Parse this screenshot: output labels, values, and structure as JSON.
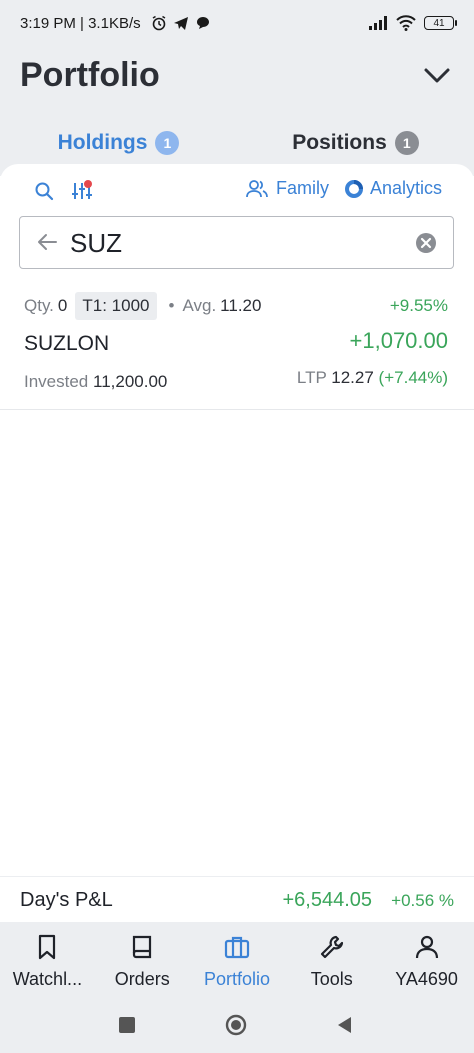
{
  "status_bar": {
    "time_speed": "3:19 PM | 3.1KB/s",
    "battery": "41"
  },
  "header": {
    "title": "Portfolio",
    "tabs": [
      {
        "label": "Holdings",
        "badge": "1"
      },
      {
        "label": "Positions",
        "badge": "1"
      }
    ]
  },
  "toolbar": {
    "family_label": "Family",
    "analytics_label": "Analytics"
  },
  "search": {
    "value": "SUZ"
  },
  "holding": {
    "qty_label": "Qty.",
    "qty_value": "0",
    "t1_label": "T1: 1000",
    "dot": "•",
    "avg_label": "Avg.",
    "avg_value": "11.20",
    "pnl_pct": "+9.55%",
    "symbol": "SUZLON",
    "pnl_value": "+1,070.00",
    "invested_label": "Invested",
    "invested_value": "11,200.00",
    "ltp_label": "LTP",
    "ltp_value": "12.27",
    "ltp_change": "(+7.44%)"
  },
  "day_pnl": {
    "label": "Day's P&L",
    "value": "+6,544.05",
    "pct": "+0.56 %"
  },
  "bottom_nav": [
    {
      "label": "Watchl...",
      "icon": "bookmark-icon"
    },
    {
      "label": "Orders",
      "icon": "book-icon"
    },
    {
      "label": "Portfolio",
      "icon": "briefcase-icon"
    },
    {
      "label": "Tools",
      "icon": "wrench-icon"
    },
    {
      "label": "YA4690",
      "icon": "user-icon"
    }
  ],
  "colors": {
    "accent": "#3b82d6",
    "positive": "#3aa55a",
    "header_bg": "#eceef1"
  }
}
